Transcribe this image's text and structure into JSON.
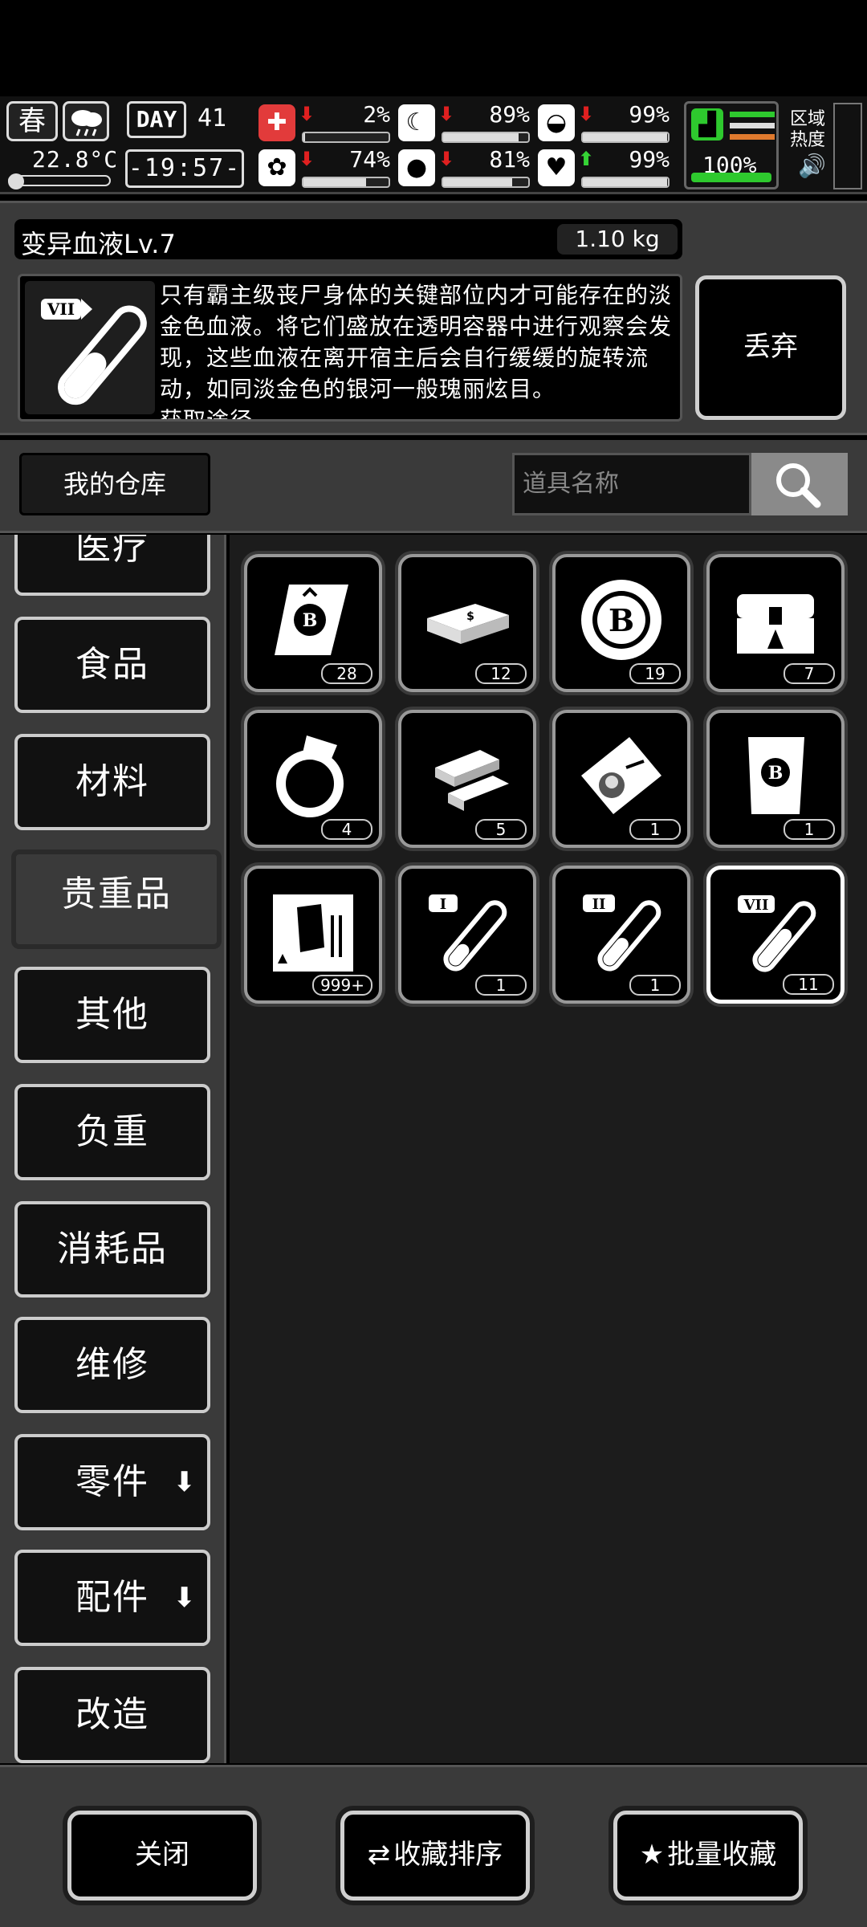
{
  "hud": {
    "season": "春",
    "temperature": "22.8°C",
    "day_label": "DAY",
    "day_number": "41",
    "clock": "-19:57-",
    "stats": [
      {
        "name": "health",
        "icon": "medkit-icon",
        "glyph": "✚",
        "trend": "down",
        "value": "2%",
        "level": 0.02
      },
      {
        "name": "hunger",
        "icon": "stomach-icon",
        "glyph": "☾",
        "trend": "down",
        "value": "89%",
        "level": 0.89
      },
      {
        "name": "sanity",
        "icon": "head-icon",
        "glyph": "◒",
        "trend": "down",
        "value": "99%",
        "level": 0.99
      },
      {
        "name": "mood",
        "icon": "brain-icon",
        "glyph": "✿",
        "trend": "down",
        "value": "74%",
        "level": 0.74
      },
      {
        "name": "thirst",
        "icon": "water-drop-icon",
        "glyph": "💧",
        "trend": "down",
        "value": "81%",
        "level": 0.81
      },
      {
        "name": "heart",
        "icon": "heart-icon",
        "glyph": "♥",
        "trend": "up",
        "value": "99%",
        "level": 0.99
      }
    ],
    "stamina": "100%",
    "region_heat": "区域\n热度"
  },
  "item_info": {
    "name": "变异血液Lv.7",
    "weight": "1.10 kg",
    "description": "只有霸主级丧尸身体的关键部位内才可能存在的淡金色血液。将它们盛放在透明容器中进行观察会发现，这些血液在离开宿主后会自行缓缓的旋转流动，如同淡金色的银河一般瑰丽炫目。\n获取途径",
    "discard_label": "丢弃"
  },
  "warehouse": {
    "title": "我的仓库",
    "search_placeholder": "道具名称"
  },
  "categories": [
    {
      "label": "医疗",
      "active": false
    },
    {
      "label": "食品",
      "active": false
    },
    {
      "label": "材料",
      "active": false
    },
    {
      "label": "贵重品",
      "active": true
    },
    {
      "label": "其他",
      "active": false
    },
    {
      "label": "负重",
      "active": false
    },
    {
      "label": "消耗品",
      "active": false
    },
    {
      "label": "维修",
      "active": false
    },
    {
      "label": "零件",
      "active": false,
      "dropdown": true
    },
    {
      "label": "配件",
      "active": false,
      "dropdown": true
    },
    {
      "label": "改造",
      "active": false
    }
  ],
  "items": [
    {
      "icon": "scroll-icon",
      "count": "28"
    },
    {
      "icon": "cash-stack-icon",
      "count": "12"
    },
    {
      "icon": "b-coin-icon",
      "count": "19"
    },
    {
      "icon": "treasure-chest-icon",
      "count": "7"
    },
    {
      "icon": "ring-icon",
      "count": "4"
    },
    {
      "icon": "gold-bars-icon",
      "count": "5"
    },
    {
      "icon": "id-ticket-icon",
      "count": "1"
    },
    {
      "icon": "b-voucher-icon",
      "count": "1"
    },
    {
      "icon": "zombie-card-icon",
      "count": "999+"
    },
    {
      "icon": "blood-vial-1-icon",
      "count": "1",
      "numeral": "I"
    },
    {
      "icon": "blood-vial-2-icon",
      "count": "1",
      "numeral": "II"
    },
    {
      "icon": "blood-vial-7-icon",
      "count": "11",
      "numeral": "VII",
      "selected": true
    }
  ],
  "bottom": {
    "close_label": "关闭",
    "sort_label": "收藏排序",
    "batch_label": "批量收藏"
  },
  "colors": {
    "panel": "#3a3a3a",
    "slot_border": "#999999",
    "accent_green": "#2ec92e",
    "trend_down": "#e02020"
  }
}
